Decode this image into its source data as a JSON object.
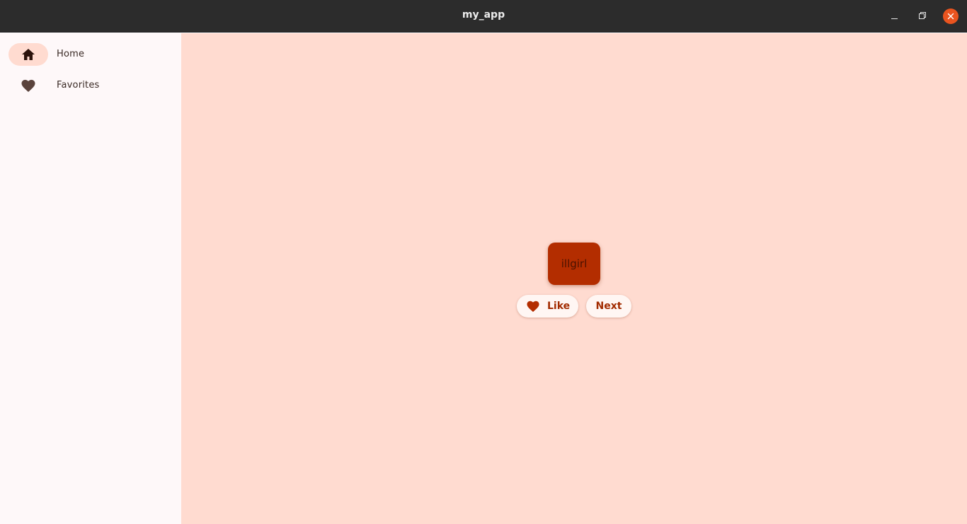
{
  "window": {
    "title": "my_app"
  },
  "sidebar": {
    "items": [
      {
        "label": "Home",
        "icon": "home-icon",
        "selected": true
      },
      {
        "label": "Favorites",
        "icon": "heart-icon",
        "selected": false
      }
    ]
  },
  "main": {
    "word": "illgirl",
    "like_label": "Like",
    "next_label": "Next"
  },
  "colors": {
    "accent": "#b32d00",
    "background": "#ffdbd0",
    "titlebar": "#2c2c2c",
    "close_button": "#e9541f"
  }
}
